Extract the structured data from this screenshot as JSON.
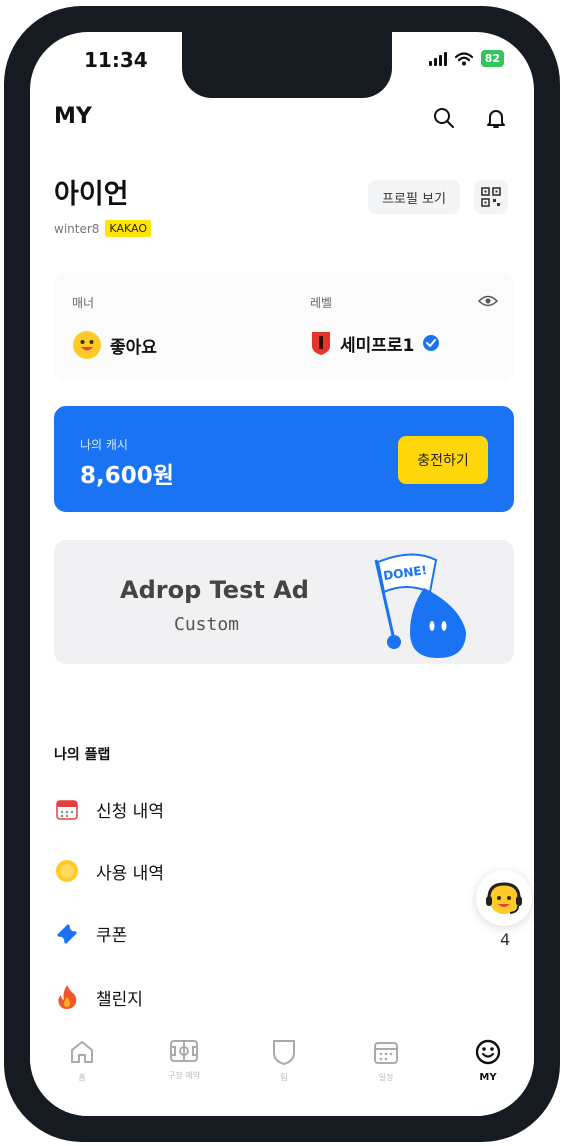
{
  "status_bar": {
    "time": "11:34",
    "battery": "82"
  },
  "header": {
    "title": "MY"
  },
  "profile": {
    "name": "아이언",
    "username": "winter8",
    "provider_badge": "KAKAO",
    "profile_button": "프로필 보기"
  },
  "stats": {
    "manner_label": "매너",
    "manner_value": "좋아요",
    "level_label": "레벨",
    "level_value": "세미프로1"
  },
  "cash": {
    "label": "나의 캐시",
    "amount": "8,600원",
    "charge_button": "충전하기"
  },
  "ad": {
    "title": "Adrop Test Ad",
    "subtitle": "Custom",
    "flag_text": "DONE!"
  },
  "my_plab": {
    "title": "나의 플랩",
    "items": [
      {
        "label": "신청 내역",
        "icon": "calendar-icon"
      },
      {
        "label": "사용 내역",
        "icon": "coin-icon"
      },
      {
        "label": "쿠폰",
        "icon": "ticket-icon"
      },
      {
        "label": "챌린지",
        "icon": "fire-icon"
      }
    ]
  },
  "support_fab": {
    "count": "4"
  },
  "tabbar": {
    "items": [
      {
        "label": "홈",
        "icon": "home-icon"
      },
      {
        "label": "구장 예약",
        "icon": "field-icon"
      },
      {
        "label": "팀",
        "icon": "shield-icon"
      },
      {
        "label": "일정",
        "icon": "calendar-icon"
      },
      {
        "label": "MY",
        "icon": "smile-icon"
      }
    ],
    "active": "MY"
  },
  "colors": {
    "primary_blue": "#1a73f2",
    "kakao_yellow": "#ffe500",
    "charge_yellow": "#ffd60a",
    "battery_green": "#33c45a"
  }
}
